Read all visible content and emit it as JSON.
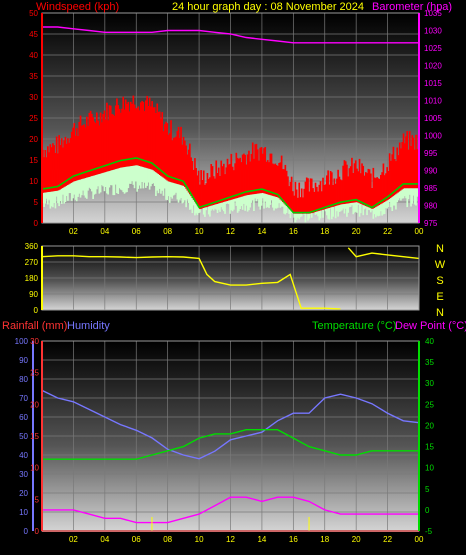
{
  "header": {
    "windspeed_label": "Windspeed (kph)",
    "title": "24 hour graph day : 08 November 2024",
    "barometer_label": "Barometer (hpa)",
    "rainfall_label": "Rainfall (mm)",
    "humidity_label": "Humidity",
    "temperature_label": "Temperature (°C)",
    "dewpoint_label": "Dew Point (°C)"
  },
  "colors": {
    "windspeed": "#ff0000",
    "wind_avg": "#00cc00",
    "wind_light": "#ccffcc",
    "barometer": "#ff00ff",
    "direction": "#ffff00",
    "rainfall": "#ff3333",
    "humidity": "#7777ff",
    "temperature": "#00dd00",
    "dewpoint": "#ff00ff"
  },
  "x_ticks": [
    "02",
    "04",
    "06",
    "08",
    "10",
    "12",
    "14",
    "16",
    "18",
    "20",
    "22",
    "00"
  ],
  "compass": [
    "N",
    "W",
    "S",
    "E",
    "N"
  ],
  "chart_data": [
    {
      "type": "line",
      "title": "24 hour graph day : 08 November 2024",
      "ylabel": "Windspeed (kph)",
      "y2label": "Barometer (hpa)",
      "ylim": [
        0,
        50
      ],
      "y_ticks": [
        0,
        5,
        10,
        15,
        20,
        25,
        30,
        35,
        40,
        45,
        50
      ],
      "y2lim": [
        975,
        1035
      ],
      "y2_ticks": [
        975,
        980,
        985,
        990,
        995,
        1000,
        1005,
        1010,
        1015,
        1020,
        1025,
        1030,
        1035
      ],
      "x": [
        0,
        1,
        2,
        3,
        4,
        5,
        6,
        7,
        8,
        9,
        10,
        11,
        12,
        13,
        14,
        15,
        16,
        17,
        18,
        19,
        20,
        21,
        22,
        23,
        24
      ],
      "series": [
        {
          "name": "Windspeed (kph)",
          "axis": "left",
          "values": [
            13,
            14,
            18,
            20,
            22,
            24,
            25,
            23,
            18,
            16,
            6,
            8,
            10,
            12,
            13,
            11,
            4,
            4,
            6,
            8,
            9,
            6,
            10,
            15,
            15
          ]
        },
        {
          "name": "Barometer (hpa)",
          "axis": "right",
          "values": [
            1031,
            1031,
            1030.5,
            1030,
            1029.5,
            1029.5,
            1029.5,
            1029.5,
            1030,
            1030,
            1030,
            1029.5,
            1029,
            1028,
            1027.5,
            1027,
            1026.5,
            1026.5,
            1026.5,
            1026.5,
            1026.5,
            1026.5,
            1026.5,
            1026.5,
            1026.5
          ]
        }
      ]
    },
    {
      "type": "scatter",
      "ylabel": "Wind direction",
      "ylim": [
        0,
        360
      ],
      "y_ticks": [
        0,
        90,
        180,
        270,
        360
      ],
      "x": [
        0,
        1,
        2,
        3,
        4,
        5,
        6,
        7,
        8,
        9,
        10,
        10.5,
        11,
        12,
        13,
        14,
        15,
        15.8,
        16.5,
        17,
        18,
        19,
        19.5,
        20,
        21,
        22,
        23,
        24
      ],
      "series": [
        {
          "name": "Wind direction",
          "values": [
            300,
            305,
            305,
            300,
            300,
            298,
            295,
            298,
            300,
            298,
            290,
            200,
            160,
            140,
            140,
            150,
            155,
            200,
            10,
            10,
            10,
            5,
            350,
            300,
            320,
            310,
            300,
            290
          ]
        }
      ]
    },
    {
      "type": "line",
      "ylabel": "Rainfall (mm) / Humidity",
      "y2label": "Temperature (°C) / Dew Point (°C)",
      "ylim": [
        0,
        100
      ],
      "y_ticks": [
        0,
        10,
        20,
        30,
        40,
        50,
        60,
        70,
        80,
        90,
        100
      ],
      "rain_ylim": [
        0,
        30
      ],
      "rain_ticks": [
        0,
        5,
        10,
        15,
        20,
        25,
        30
      ],
      "y2lim": [
        -5,
        40
      ],
      "y2_ticks": [
        -5,
        0,
        5,
        10,
        15,
        20,
        25,
        30,
        35,
        40
      ],
      "x": [
        0,
        1,
        2,
        3,
        4,
        5,
        6,
        7,
        8,
        9,
        10,
        11,
        12,
        13,
        14,
        15,
        16,
        17,
        18,
        19,
        20,
        21,
        22,
        23,
        24
      ],
      "series": [
        {
          "name": "Humidity",
          "axis": "left",
          "values": [
            74,
            70,
            68,
            64,
            60,
            56,
            53,
            49,
            43,
            40,
            38,
            42,
            48,
            50,
            52,
            58,
            62,
            62,
            70,
            72,
            70,
            67,
            62,
            58,
            57
          ]
        },
        {
          "name": "Temperature (°C)",
          "axis": "right",
          "values": [
            12,
            12,
            12,
            12,
            12,
            12,
            12,
            13,
            14,
            15,
            17,
            18,
            18,
            19,
            19,
            19,
            17,
            15,
            14,
            13,
            13,
            14,
            14,
            14,
            14
          ]
        },
        {
          "name": "Dew Point (°C)",
          "axis": "right",
          "values": [
            0,
            0,
            0,
            -1,
            -2,
            -2,
            -3,
            -3,
            -3,
            -2,
            -1,
            1,
            3,
            3,
            2,
            3,
            3,
            2,
            0,
            -1,
            -1,
            -1,
            -1,
            -1,
            -1
          ]
        },
        {
          "name": "Rainfall (mm)",
          "axis": "rain",
          "values": [
            0,
            0,
            0,
            0,
            0,
            0,
            0,
            0,
            0,
            0,
            0,
            0,
            0,
            0,
            0,
            0,
            0,
            0,
            0,
            0,
            0,
            0,
            0,
            0,
            0
          ]
        }
      ]
    }
  ]
}
